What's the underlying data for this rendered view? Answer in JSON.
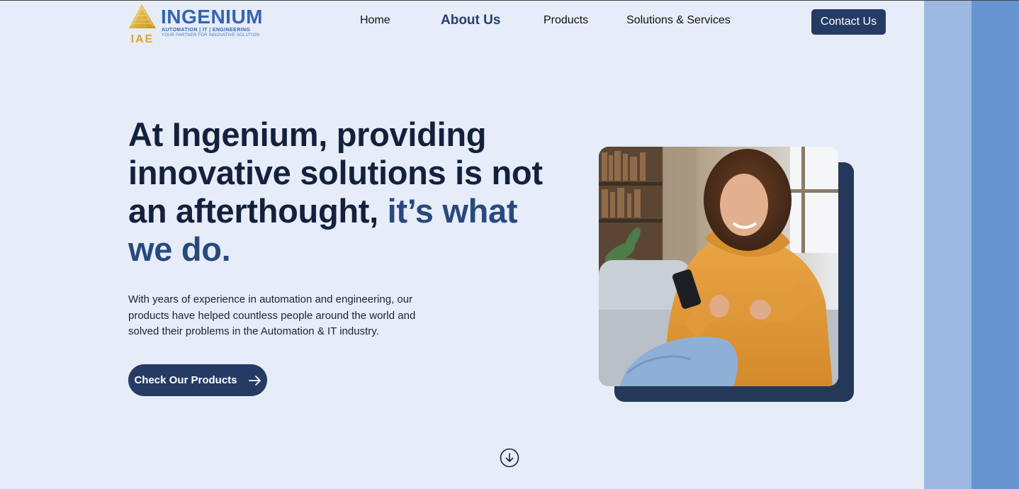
{
  "logo": {
    "name": "INGENIUM",
    "mark_text": "IAE",
    "tagline": "AUTOMATION | IT | ENGINEERING",
    "slogan": "YOUR PARTNER FOR INNOVATIVE SOLUTION"
  },
  "nav": {
    "items": [
      {
        "label": "Home"
      },
      {
        "label": "About Us"
      },
      {
        "label": "Products"
      },
      {
        "label": "Solutions & Services"
      }
    ],
    "contact_label": "Contact Us"
  },
  "hero": {
    "headline_main": "At Ingenium, providing innovative solutions is not an afterthought,",
    "headline_accent": "it’s what we do.",
    "description": "With years of experience in automation and engineering, our products have helped countless people around the world and solved their problems in the Automation & IT industry.",
    "cta_label": "Check Our Products"
  },
  "colors": {
    "background": "#e6ecf8",
    "primary": "#253b64",
    "accent_text": "#29497e",
    "logo_blue": "#3465b3",
    "logo_gold": "#e0b43a",
    "stripe_light": "#9cb8e2",
    "stripe_dark": "#6895cf"
  },
  "icons": {
    "cta_arrow": "arrow-right-icon",
    "scroll": "arrow-down-circle-icon",
    "logo": "pyramid-logo-icon"
  }
}
